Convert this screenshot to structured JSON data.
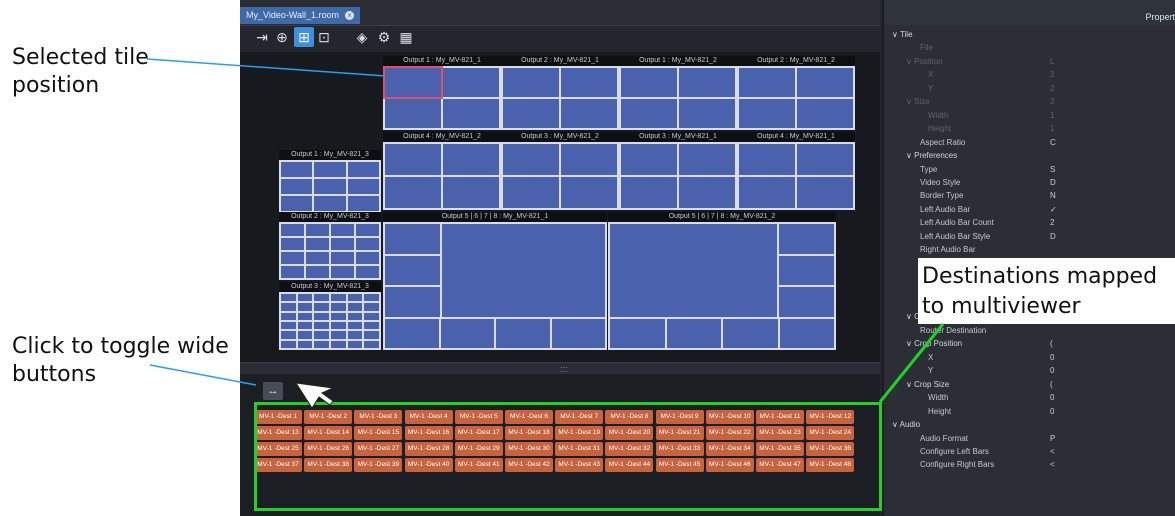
{
  "tab": {
    "title": "My_Video-Wall_1.room",
    "close_glyph": "×"
  },
  "toolbar": [
    {
      "icon": "exit-icon",
      "glyph": "⇥"
    },
    {
      "icon": "add-icon",
      "glyph": "⊕"
    },
    {
      "icon": "snap-grid-icon",
      "glyph": "⊞",
      "active": true
    },
    {
      "icon": "fit-icon",
      "glyph": "⊡"
    },
    {
      "icon": "layers-icon",
      "glyph": "◈"
    },
    {
      "icon": "settings-icon",
      "glyph": "⚙"
    },
    {
      "icon": "tiles-icon",
      "glyph": "▦"
    }
  ],
  "tiles": [
    {
      "label": "Output 1 : My_MV-821_1",
      "cols": 2,
      "rows": 2,
      "selected_cell": 0
    },
    {
      "label": "Output 2 : My_MV-821_1",
      "cols": 2,
      "rows": 2
    },
    {
      "label": "Output 1 : My_MV-821_2",
      "cols": 2,
      "rows": 2
    },
    {
      "label": "Output 2 : My_MV-821_2",
      "cols": 2,
      "rows": 2
    },
    {
      "label": "Output 4 : My_MV-821_2",
      "cols": 2,
      "rows": 2
    },
    {
      "label": "Output 3 : My_MV-821_2",
      "cols": 2,
      "rows": 2
    },
    {
      "label": "Output 3 : My_MV-821_1",
      "cols": 2,
      "rows": 2
    },
    {
      "label": "Output 4 : My_MV-821_1",
      "cols": 2,
      "rows": 2
    },
    {
      "label": "Output 1 : My_MV-821_3",
      "cols": 3,
      "rows": 3
    },
    {
      "label": "Output 2 : My_MV-821_3",
      "cols": 4,
      "rows": 4
    },
    {
      "label": "Output 3 : My_MV-821_3",
      "cols": 6,
      "rows": 6
    },
    {
      "label": "Output 5 | 6 | 7 | 8 : My_MV-821_1",
      "cols": 0,
      "rows": 0
    },
    {
      "label": "Output 5 | 6 | 7 | 8 : My_MV-821_2",
      "cols": 0,
      "rows": 0
    }
  ],
  "splitter_glyph": ":::",
  "wide_button_glyph": "↔",
  "destinations": [
    "MV-1 -Dest 1",
    "MV-1 -Dest 2",
    "MV-1 -Dest 3",
    "MV-1 -Dest 4",
    "MV-1 -Dest 5",
    "MV-1 -Dest 6",
    "MV-1 -Dest 7",
    "MV-1 -Dest 8",
    "MV-1 -Dest 9",
    "MV-1 -Dest 10",
    "MV-1 -Dest 11",
    "MV-1 -Dest 12",
    "MV-1 -Dest 13",
    "MV-1 -Dest 14",
    "MV-1 -Dest 15",
    "MV-1 -Dest 16",
    "MV-1 -Dest 17",
    "MV-1 -Dest 18",
    "MV-1 -Dest 19",
    "MV-1 -Dest 20",
    "MV-1 -Dest 21",
    "MV-1 -Dest 22",
    "MV-1 -Dest 23",
    "MV-1 -Dest 24",
    "MV-1 -Dest 25",
    "MV-1 -Dest 26",
    "MV-1 -Dest 27",
    "MV-1 -Dest 28",
    "MV-1 -Dest 29",
    "MV-1 -Dest 30",
    "MV-1 -Dest 31",
    "MV-1 -Dest 32",
    "MV-1 -Dest 33",
    "MV-1 -Dest 34",
    "MV-1 -Dest 35",
    "MV-1 -Dest 36",
    "MV-1 -Dest 37",
    "MV-1 -Dest 38",
    "MV-1 -Dest 39",
    "MV-1 -Dest 40",
    "MV-1 -Dest 41",
    "MV-1 -Dest 42",
    "MV-1 -Dest 43",
    "MV-1 -Dest 44",
    "MV-1 -Dest 45",
    "MV-1 -Dest 46",
    "MV-1 -Dest 47",
    "MV-1 -Dest 48"
  ],
  "properties": {
    "title": "Properti",
    "rows": [
      {
        "label": "Tile",
        "level": 0,
        "expand": true,
        "dim": false,
        "value": ""
      },
      {
        "label": "File",
        "level": 2,
        "dim": true,
        "value": ""
      },
      {
        "label": "Position",
        "level": 1,
        "expand": true,
        "dim": true,
        "value": "L"
      },
      {
        "label": "X",
        "level": 3,
        "dim": true,
        "value": "2"
      },
      {
        "label": "Y",
        "level": 3,
        "dim": true,
        "value": "2"
      },
      {
        "label": "Size",
        "level": 1,
        "expand": true,
        "dim": true,
        "value": "2"
      },
      {
        "label": "Width",
        "level": 3,
        "dim": true,
        "value": "1"
      },
      {
        "label": "Height",
        "level": 3,
        "dim": true,
        "value": "1"
      },
      {
        "label": "Aspect Ratio",
        "level": 2,
        "dim": false,
        "value": "C"
      },
      {
        "label": "Preferences",
        "level": 1,
        "expand": true,
        "dim": false,
        "value": ""
      },
      {
        "label": "Type",
        "level": 2,
        "dim": false,
        "value": "S"
      },
      {
        "label": "Video Style",
        "level": 2,
        "dim": false,
        "value": "D"
      },
      {
        "label": "Border Type",
        "level": 2,
        "dim": false,
        "value": "N"
      },
      {
        "label": "Left Audio Bar",
        "level": 2,
        "dim": false,
        "value": "✓"
      },
      {
        "label": "Left Audio Bar Count",
        "level": 2,
        "dim": false,
        "value": "2"
      },
      {
        "label": "Left Audio Bar Style",
        "level": 2,
        "dim": false,
        "value": "D"
      },
      {
        "label": "Right Audio Bar",
        "level": 2,
        "dim": false,
        "value": ""
      },
      {
        "label": "Right Audio Bar Count",
        "level": 2,
        "dim": false,
        "value": "2"
      },
      {
        "label": "Closed Captions Style",
        "level": 2,
        "dim": false,
        "value": "C"
      },
      {
        "label": "Streaming Video",
        "level": 2,
        "dim": false,
        "value": ""
      },
      {
        "label": "GPI",
        "level": 2,
        "dim": false,
        "value": ""
      },
      {
        "label": "Configuration",
        "level": 1,
        "expand": true,
        "dim": false,
        "value": ""
      },
      {
        "label": "Router Destination",
        "level": 2,
        "dim": false,
        "value": ""
      },
      {
        "label": "Crop Position",
        "level": 1,
        "expand": true,
        "dim": false,
        "value": "("
      },
      {
        "label": "X",
        "level": 3,
        "dim": false,
        "value": "0"
      },
      {
        "label": "Y",
        "level": 3,
        "dim": false,
        "value": "0"
      },
      {
        "label": "Crop Size",
        "level": 1,
        "expand": true,
        "dim": false,
        "value": "("
      },
      {
        "label": "Width",
        "level": 3,
        "dim": false,
        "value": "0"
      },
      {
        "label": "Height",
        "level": 3,
        "dim": false,
        "value": "0"
      },
      {
        "label": "Audio",
        "level": 0,
        "expand": true,
        "dim": false,
        "value": ""
      },
      {
        "label": "Audio Format",
        "level": 2,
        "dim": false,
        "value": "P"
      },
      {
        "label": "Configure Left Bars",
        "level": 2,
        "dim": false,
        "value": "<"
      },
      {
        "label": "Configure Right Bars",
        "level": 2,
        "dim": false,
        "value": "<"
      }
    ]
  },
  "callouts": {
    "selected_tile": "Selected tile position",
    "destinations": "Destinations mapped to multiviewer",
    "toggle_wide": "Click to toggle wide buttons"
  },
  "colors": {
    "accent": "#3d8fe0",
    "dest_button": "#c7643f",
    "highlight_box": "#22d127",
    "callout_line": "#2a9df4",
    "selected_cell_border": "#e0506a"
  }
}
